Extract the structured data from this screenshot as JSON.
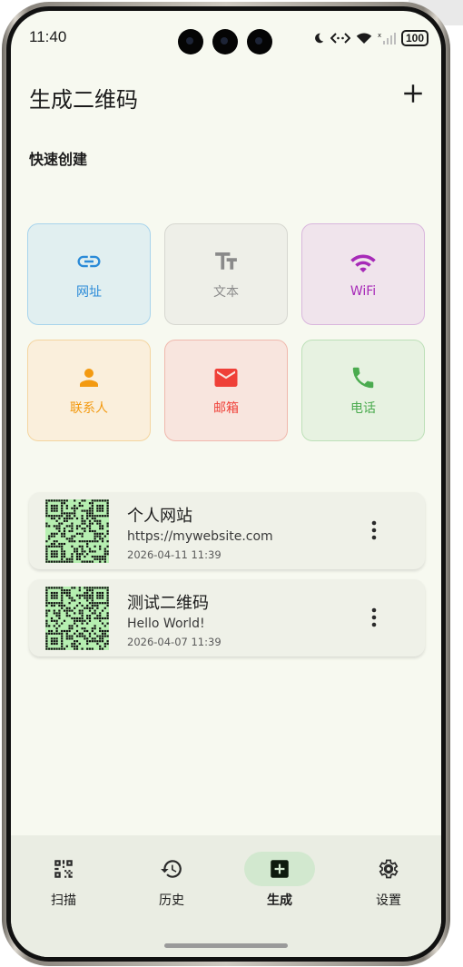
{
  "status_bar": {
    "time": "11:40",
    "battery": "100",
    "icons": [
      "moon-icon",
      "data-transfer-icon",
      "wifi-icon",
      "signal-icon"
    ]
  },
  "header": {
    "title": "生成二维码",
    "add_icon": "plus-icon"
  },
  "quick_create": {
    "title": "快速创建",
    "tiles": [
      {
        "label": "网址",
        "icon": "link-icon",
        "color": "#2b8bd8",
        "bg": "#e1eff0",
        "border": "#a8d4ec"
      },
      {
        "label": "文本",
        "icon": "text-icon",
        "color": "#8a8a8a",
        "bg": "#eeefe8",
        "border": "#d6d7d0"
      },
      {
        "label": "WiFi",
        "icon": "wifi-icon",
        "color": "#a72ab8",
        "bg": "#f0e4ec",
        "border": "#d9b6dd"
      },
      {
        "label": "联系人",
        "icon": "person-icon",
        "color": "#f39a11",
        "bg": "#faefdc",
        "border": "#f4d5a0"
      },
      {
        "label": "邮箱",
        "icon": "mail-icon",
        "color": "#ef4038",
        "bg": "#f8e5de",
        "border": "#f0b8ad"
      },
      {
        "label": "电话",
        "icon": "phone-icon",
        "color": "#4bab4f",
        "bg": "#e7f2e1",
        "border": "#bde0b8"
      }
    ]
  },
  "history": [
    {
      "title": "个人网站",
      "content": "https://mywebsite.com",
      "date": "2026-04-11 11:39"
    },
    {
      "title": "测试二维码",
      "content": "Hello World!",
      "date": "2026-04-07 11:39"
    }
  ],
  "bottom_nav": {
    "active": "生成",
    "items": [
      {
        "label": "扫描",
        "icon": "scan-icon"
      },
      {
        "label": "历史",
        "icon": "history-icon"
      },
      {
        "label": "生成",
        "icon": "add-box-icon"
      },
      {
        "label": "设置",
        "icon": "gear-icon"
      }
    ]
  },
  "colors": {
    "screen_bg": "#f7f9f0",
    "nav_bg": "#eaede3",
    "nav_active_pill": "#d2e8cf",
    "qr_light": "#b6efb1",
    "qr_dark": "#111111"
  }
}
